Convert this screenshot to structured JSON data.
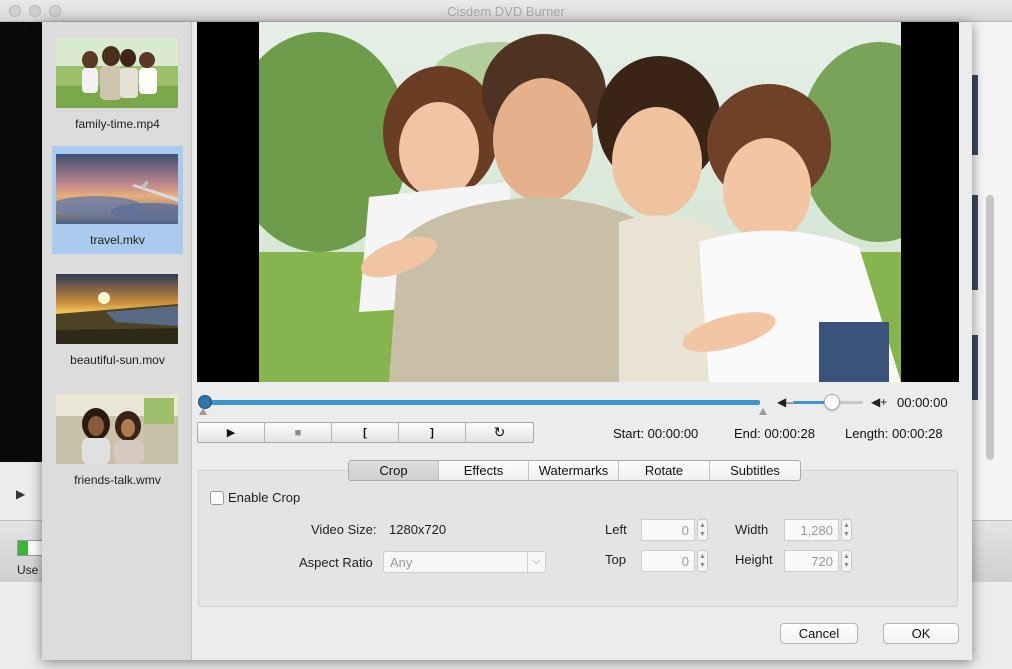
{
  "window": {
    "title": "Cisdem DVD Burner"
  },
  "background": {
    "used_label": "Use"
  },
  "files": [
    {
      "name": "family-time.mp4",
      "selected": false
    },
    {
      "name": "travel.mkv",
      "selected": true
    },
    {
      "name": "beautiful-sun.mov",
      "selected": false
    },
    {
      "name": "friends-talk.wmv",
      "selected": false
    }
  ],
  "player": {
    "current_time": "00:00:00",
    "start": "Start: 00:00:00",
    "end": "End: 00:00:28",
    "length": "Length: 00:00:28",
    "volume_level": 0.5,
    "progress": 0.0
  },
  "controls": {
    "play_icon": "play-icon",
    "stop_icon": "stop-icon",
    "mark_in_icon": "mark-in-icon",
    "mark_out_icon": "mark-out-icon",
    "reset_icon": "reset-icon"
  },
  "tabs": [
    {
      "label": "Crop",
      "active": true
    },
    {
      "label": "Effects",
      "active": false
    },
    {
      "label": "Watermarks",
      "active": false
    },
    {
      "label": "Rotate",
      "active": false
    },
    {
      "label": "Subtitles",
      "active": false
    }
  ],
  "crop": {
    "enable_label": "Enable Crop",
    "enabled": false,
    "video_size_label": "Video Size:",
    "video_size_value": "1280x720",
    "aspect_ratio_label": "Aspect Ratio",
    "aspect_ratio_value": "Any",
    "left_label": "Left",
    "left_value": "0",
    "top_label": "Top",
    "top_value": "0",
    "width_label": "Width",
    "width_value": "1,280",
    "height_label": "Height",
    "height_value": "720"
  },
  "buttons": {
    "cancel": "Cancel",
    "ok": "OK"
  },
  "colors": {
    "accent": "#3e94cc",
    "selection": "#aacbee"
  }
}
